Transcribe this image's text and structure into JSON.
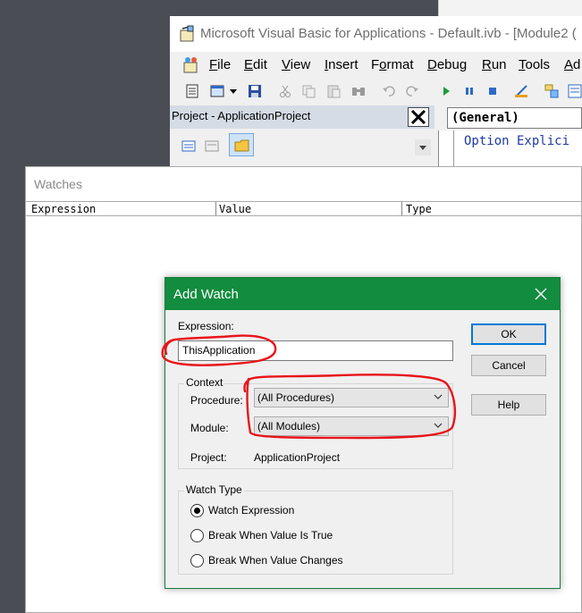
{
  "vba_window": {
    "title": "Microsoft Visual Basic for Applications - Default.ivb - [Module2 (",
    "menu": [
      "File",
      "Edit",
      "View",
      "Insert",
      "Format",
      "Debug",
      "Run",
      "Tools",
      "Ad"
    ],
    "menu_mnemonic": [
      "F",
      "E",
      "V",
      "I",
      "o",
      "D",
      "R",
      "T",
      "A"
    ],
    "project_panel_title": "Project - ApplicationProject",
    "code_combo": "(General)",
    "code_line": "Option Explici"
  },
  "watches_window": {
    "title": "Watches",
    "columns": [
      "Expression",
      "Value",
      "Type"
    ]
  },
  "dialog": {
    "title": "Add Watch",
    "expression_label": "Expression:",
    "expression_value": "ThisApplication",
    "context_label": "Context",
    "procedure_label": "Procedure:",
    "procedure_value": "(All Procedures)",
    "module_label": "Module:",
    "module_value": "(All Modules)",
    "project_label": "Project:",
    "project_value": "ApplicationProject",
    "watch_type_label": "Watch Type",
    "watch_types": [
      {
        "label": "Watch Expression",
        "selected": true
      },
      {
        "label": "Break When Value Is True",
        "selected": false
      },
      {
        "label": "Break When Value Changes",
        "selected": false
      }
    ],
    "buttons": {
      "ok": "OK",
      "cancel": "Cancel",
      "help": "Help"
    }
  },
  "colors": {
    "dialog_title_bar": "#128c3e",
    "annotation": "#e8141a",
    "desktop": "#4a4e54"
  }
}
